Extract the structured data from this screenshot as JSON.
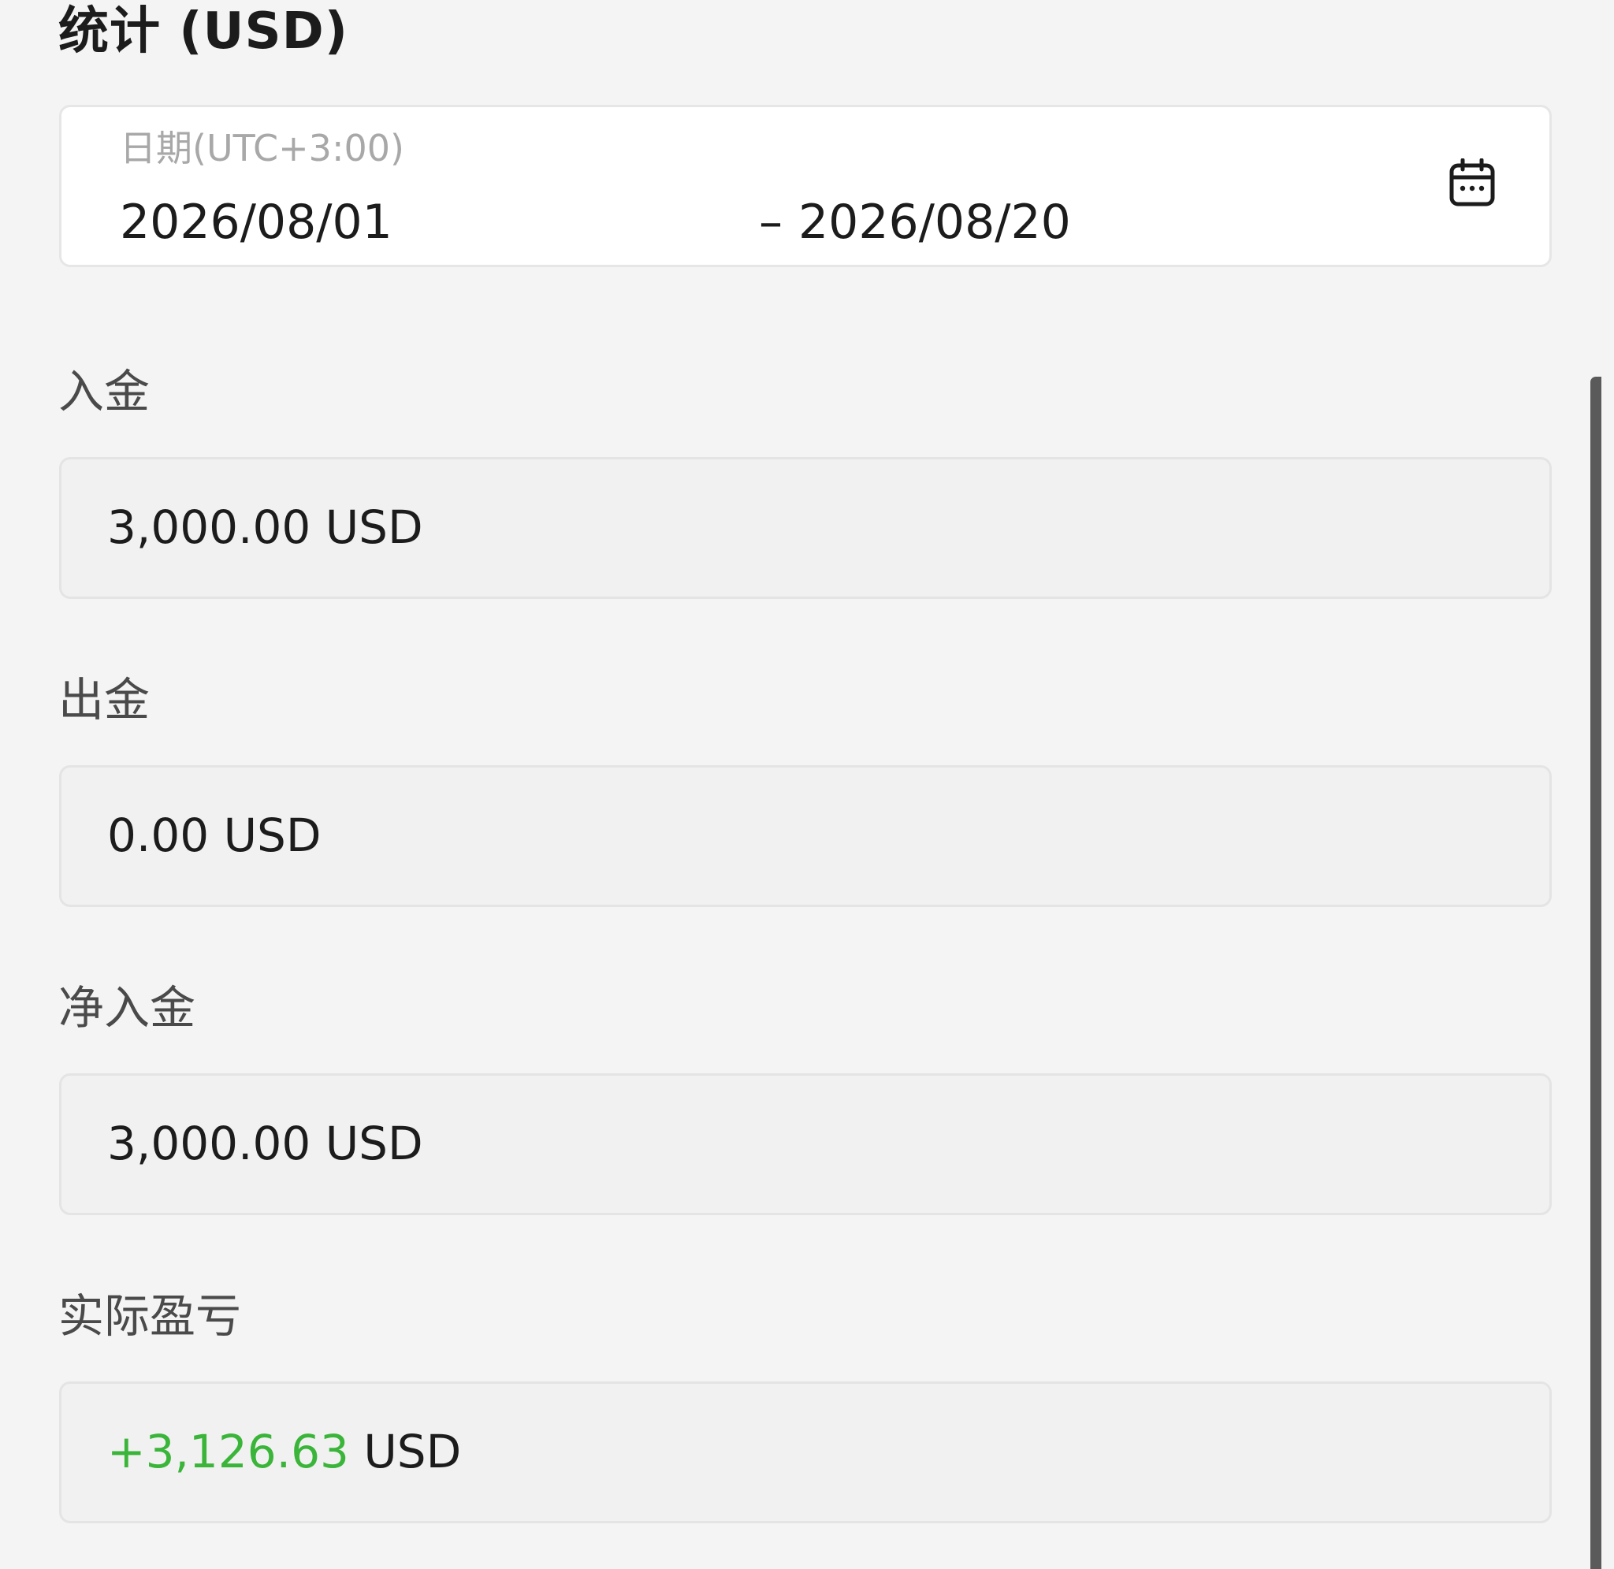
{
  "header": {
    "title": "统计 (USD)"
  },
  "date_range": {
    "label": "日期(UTC+3:00)",
    "start": "2026/08/01",
    "separator": "–",
    "end": "2026/08/20",
    "icon": "calendar-icon"
  },
  "stats": {
    "deposit": {
      "label": "入金",
      "value": "3,000.00 USD"
    },
    "withdrawal": {
      "label": "出金",
      "value": "0.00 USD"
    },
    "net_deposit": {
      "label": "净入金",
      "value": "3,000.00 USD"
    },
    "actual_pnl": {
      "label": "实际盈亏",
      "amount": "+3,126.63",
      "unit": " USD"
    }
  },
  "colors": {
    "positive": "#3ab53a",
    "background": "#f4f4f4",
    "card": "#ffffff",
    "field": "#f1f1f1"
  }
}
